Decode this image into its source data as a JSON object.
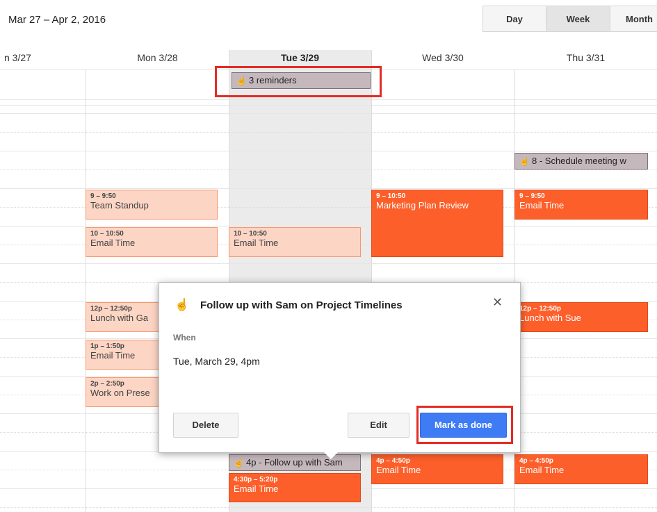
{
  "header": {
    "date_range": "Mar 27 – Apr 2, 2016"
  },
  "views": {
    "day": "Day",
    "week": "Week",
    "month": "Month"
  },
  "days": [
    {
      "label": "n 3/27"
    },
    {
      "label": "Mon 3/28"
    },
    {
      "label": "Tue 3/29"
    },
    {
      "label": "Wed 3/30"
    },
    {
      "label": "Thu 3/31"
    }
  ],
  "all_day": {
    "reminders": "3 reminders"
  },
  "reminders": {
    "thu_8": "8 - Schedule meeting w",
    "tue_4p": "4p - Follow up with Sam"
  },
  "events": {
    "mon_standup": {
      "time": "9 – 9:50",
      "name": "Team Standup"
    },
    "mon_email": {
      "time": "10 – 10:50",
      "name": "Email Time"
    },
    "mon_lunch": {
      "time": "12p – 12:50p",
      "name": "Lunch with Ga"
    },
    "mon_email2": {
      "time": "1p – 1:50p",
      "name": "Email Time"
    },
    "mon_work": {
      "time": "2p – 2:50p",
      "name": "Work on Prese"
    },
    "tue_email": {
      "time": "10 – 10:50",
      "name": "Email Time"
    },
    "tue_email2": {
      "time": "4:30p – 5:20p",
      "name": "Email Time"
    },
    "wed_marketing": {
      "time": "9 – 10:50",
      "name": "Marketing Plan Review"
    },
    "wed_email": {
      "time": "4p – 4:50p",
      "name": "Email Time"
    },
    "thu_email": {
      "time": "9 – 9:50",
      "name": "Email Time"
    },
    "thu_lunch": {
      "time": "12p – 12:50p",
      "name": "Lunch with Sue"
    },
    "thu_email2": {
      "time": "4p – 4:50p",
      "name": "Email Time"
    }
  },
  "popup": {
    "title": "Follow up with Sam on Project Timelines",
    "when_label": "When",
    "when_value": "Tue, March 29, 4pm",
    "delete": "Delete",
    "edit": "Edit",
    "mark_done": "Mark as done",
    "close": "✕"
  },
  "colors": {
    "event_light": "#fdd5c4",
    "event_dark": "#fd5f2b",
    "primary_button": "#3e7bf4",
    "highlight": "#e52b25"
  }
}
